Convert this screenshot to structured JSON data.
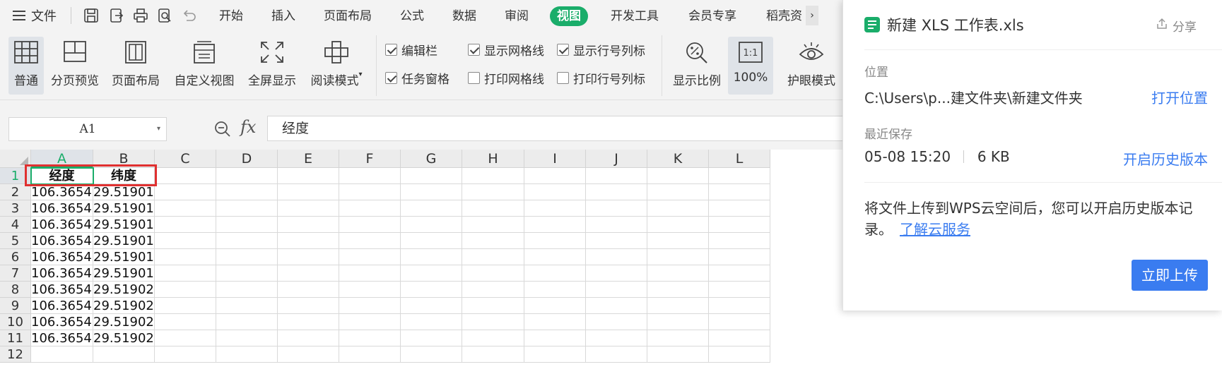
{
  "menubar": {
    "file_label": "文件",
    "tabs": [
      {
        "label": "开始"
      },
      {
        "label": "插入"
      },
      {
        "label": "页面布局"
      },
      {
        "label": "公式"
      },
      {
        "label": "数据"
      },
      {
        "label": "审阅"
      },
      {
        "label": "视图",
        "active": true
      },
      {
        "label": "开发工具"
      },
      {
        "label": "会员专享"
      },
      {
        "label": "稻壳资"
      }
    ],
    "more_glyph": "›"
  },
  "ribbon": {
    "normal": "普通",
    "page_break_preview": "分页预览",
    "page_layout": "页面布局",
    "custom_view": "自定义视图",
    "full_screen": "全屏显示",
    "reading_mode": "阅读模式",
    "checkboxes": {
      "edit_bar": {
        "label": "编辑栏",
        "checked": true
      },
      "task_pane": {
        "label": "任务窗格",
        "checked": true
      },
      "show_gridlines": {
        "label": "显示网格线",
        "checked": true
      },
      "print_gridlines": {
        "label": "打印网格线",
        "checked": false
      },
      "show_headings": {
        "label": "显示行号列标",
        "checked": true
      },
      "print_headings": {
        "label": "打印行号列标",
        "checked": false
      }
    },
    "zoom_ratio": "显示比例",
    "zoom_100": "100%",
    "zoom_100_icon_text": "1:1",
    "eye_protection": "护眼模式"
  },
  "formula_bar": {
    "name_box": "A1",
    "fx_label": "fx",
    "content": "经度"
  },
  "sheet": {
    "columns": [
      "A",
      "B",
      "C",
      "D",
      "E",
      "F",
      "G",
      "H",
      "I",
      "J",
      "K",
      "L"
    ],
    "rows": [
      [
        "经度",
        "纬度"
      ],
      [
        "106.3654",
        "29.51901"
      ],
      [
        "106.3654",
        "29.51901"
      ],
      [
        "106.3654",
        "29.51901"
      ],
      [
        "106.3654",
        "29.51901"
      ],
      [
        "106.3654",
        "29.51901"
      ],
      [
        "106.3654",
        "29.51901"
      ],
      [
        "106.3654",
        "29.51902"
      ],
      [
        "106.3654",
        "29.51902"
      ],
      [
        "106.3654",
        "29.51902"
      ],
      [
        "106.3654",
        "29.51902"
      ],
      [
        "",
        ""
      ]
    ],
    "row_numbers": [
      "1",
      "2",
      "3",
      "4",
      "5",
      "6",
      "7",
      "8",
      "9",
      "10",
      "11",
      "12"
    ]
  },
  "popup": {
    "file_name": "新建 XLS 工作表.xls",
    "share": "分享",
    "location_label": "位置",
    "location_value": "C:\\Users\\p...建文件夹\\新建文件夹",
    "open_location": "打开位置",
    "last_saved_label": "最近保存",
    "saved_time": "05-08 15:20",
    "file_size": "6 KB",
    "history_link": "开启历史版本",
    "description": "将文件上传到WPS云空间后，您可以开启历史版本记录。",
    "learn_cloud": "了解云服务",
    "upload_button": "立即上传"
  },
  "colors": {
    "accent_green": "#1aad6a",
    "link_blue": "#3a7cf0",
    "highlight_red": "#e03030"
  }
}
